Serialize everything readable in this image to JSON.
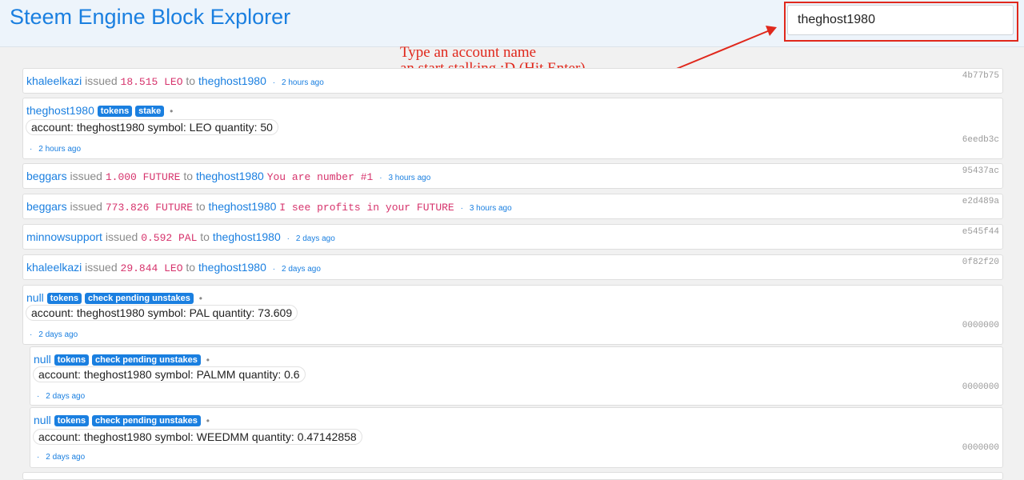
{
  "header": {
    "title": "Steem Engine Block Explorer",
    "search_value": "theghost1980"
  },
  "annotation": {
    "line1": "Type an account name",
    "line2": "an start stalking :D (Hit Enter)"
  },
  "tx": [
    {
      "from": "khaleelkazi",
      "verb": "issued",
      "amount": "18.515 LEO",
      "to_word": "to",
      "to": "theghost1980",
      "memo": "",
      "sep": "·",
      "time": "2 hours ago",
      "hash": "4b77b75"
    },
    {
      "account": "theghost1980",
      "badges": [
        "tokens",
        "stake"
      ],
      "bullet": "•",
      "params": "account: theghost1980 symbol: LEO quantity: 50",
      "sep": "·",
      "time": "2 hours ago",
      "hash": "6eedb3c"
    },
    {
      "from": "beggars",
      "verb": "issued",
      "amount": "1.000 FUTURE",
      "to_word": "to",
      "to": "theghost1980",
      "memo": "You are number #1",
      "sep": "·",
      "time": "3 hours ago",
      "hash": "95437ac"
    },
    {
      "from": "beggars",
      "verb": "issued",
      "amount": "773.826 FUTURE",
      "to_word": "to",
      "to": "theghost1980",
      "memo": "I see profits in your FUTURE",
      "sep": "·",
      "time": "3 hours ago",
      "hash": "e2d489a"
    },
    {
      "from": "minnowsupport",
      "verb": "issued",
      "amount": "0.592 PAL",
      "to_word": "to",
      "to": "theghost1980",
      "memo": "",
      "sep": "·",
      "time": "2 days ago",
      "hash": "e545f44"
    },
    {
      "from": "khaleelkazi",
      "verb": "issued",
      "amount": "29.844 LEO",
      "to_word": "to",
      "to": "theghost1980",
      "memo": "",
      "sep": "·",
      "time": "2 days ago",
      "hash": "0f82f20"
    },
    {
      "account": "null",
      "badges": [
        "tokens",
        "check pending unstakes"
      ],
      "bullet": "•",
      "params": "account: theghost1980 symbol: PAL quantity: 73.609",
      "sep": "·",
      "time": "2 days ago",
      "hash": "0000000"
    },
    {
      "account": "null",
      "badges": [
        "tokens",
        "check pending unstakes"
      ],
      "bullet": "•",
      "params": "account: theghost1980 symbol: PALMM quantity: 0.6",
      "sep": "·",
      "time": "2 days ago",
      "hash": "0000000"
    },
    {
      "account": "null",
      "badges": [
        "tokens",
        "check pending unstakes"
      ],
      "bullet": "•",
      "params": "account: theghost1980 symbol: WEEDMM quantity: 0.47142858",
      "sep": "·",
      "time": "2 days ago",
      "hash": "0000000"
    }
  ]
}
